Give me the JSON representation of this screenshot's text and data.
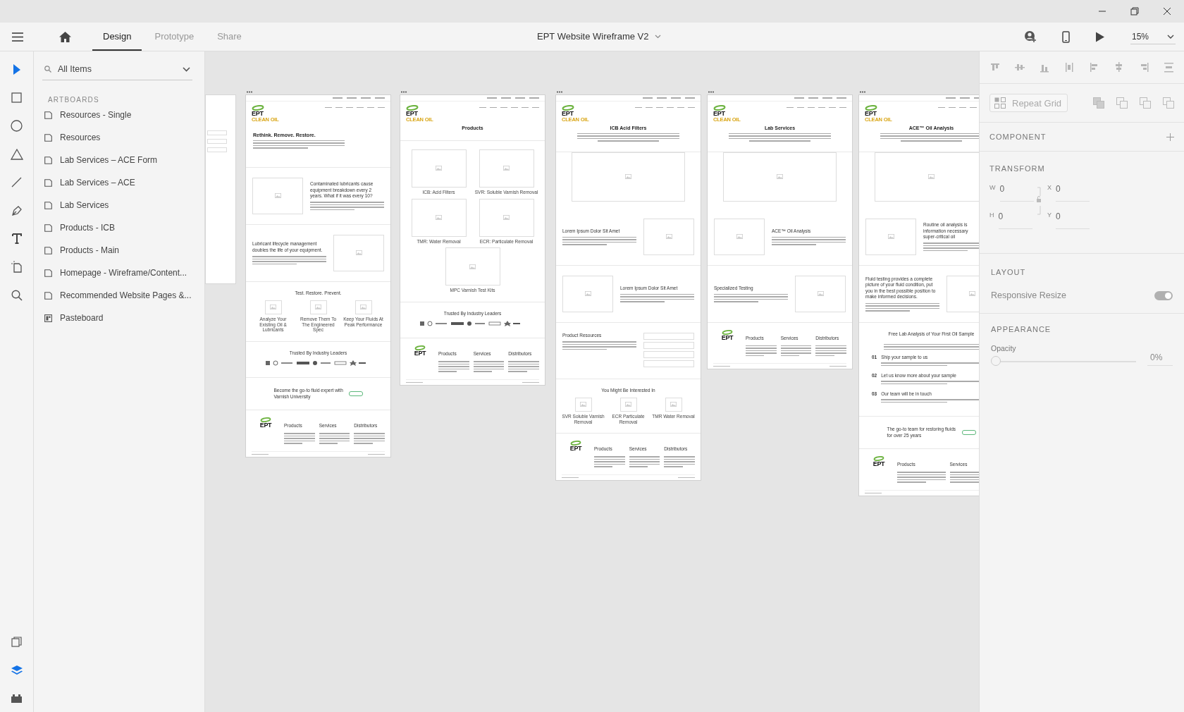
{
  "window": {
    "title": "EPT Website Wireframe V2"
  },
  "tabs": [
    {
      "label": "Design",
      "selected": true
    },
    {
      "label": "Prototype",
      "selected": false
    },
    {
      "label": "Share",
      "selected": false
    }
  ],
  "zoom": "15%",
  "tools": [
    {
      "kind": "select",
      "selected": true
    },
    {
      "kind": "rectangle",
      "selected": false
    },
    {
      "kind": "ellipse",
      "selected": false
    },
    {
      "kind": "polygon",
      "selected": false
    },
    {
      "kind": "line",
      "selected": false
    },
    {
      "kind": "pen",
      "selected": false
    },
    {
      "kind": "text",
      "selected": false
    },
    {
      "kind": "artboard",
      "selected": false
    },
    {
      "kind": "zoom",
      "selected": false
    }
  ],
  "bottom_tools": [
    {
      "kind": "assets",
      "selected": false
    },
    {
      "kind": "layers",
      "selected": true
    },
    {
      "kind": "plugins",
      "selected": false
    }
  ],
  "layers": {
    "filter": "All Items",
    "heading": "ARTBOARDS",
    "items": [
      {
        "label": "Resources - Single",
        "kind": "artboard"
      },
      {
        "label": "Resources",
        "kind": "artboard"
      },
      {
        "label": "Lab Services – ACE Form",
        "kind": "artboard"
      },
      {
        "label": "Lab Services – ACE",
        "kind": "artboard"
      },
      {
        "label": "Lab Services",
        "kind": "artboard"
      },
      {
        "label": "Products - ICB",
        "kind": "artboard"
      },
      {
        "label": "Products - Main",
        "kind": "artboard"
      },
      {
        "label": "Homepage - Wireframe/Content...",
        "kind": "artboard"
      },
      {
        "label": "Recommended Website Pages &...",
        "kind": "artboard"
      },
      {
        "label": "Pasteboard",
        "kind": "pasteboard"
      }
    ]
  },
  "properties": {
    "repeat_grid": "Repeat Grid",
    "component": "COMPONENT",
    "transform": "TRANSFORM",
    "fields": [
      {
        "label": "W",
        "value": "0"
      },
      {
        "label": "X",
        "value": "0"
      },
      {
        "label": "H",
        "value": "0"
      },
      {
        "label": "Y",
        "value": "0"
      }
    ],
    "layout": "LAYOUT",
    "responsive_resize": {
      "label": "Responsive Resize",
      "on": true
    },
    "appearance": "APPEARANCE",
    "opacity": {
      "label": "Opacity",
      "level": 0,
      "reading": "0%"
    }
  },
  "artboards": [
    {
      "sections": [
        {
          "kind": "hero_left",
          "logo": "EPT",
          "tagline": "CLEAN OIL",
          "title": "Rethink. Remove. Restore."
        },
        {
          "kind": "media_left",
          "title": "Contaminated lubricants cause equipment breakdown every 2 years. What if it was every 10?"
        },
        {
          "kind": "media_right",
          "title": "Lubricant lifecycle management doubles the life of your equipment."
        },
        {
          "kind": "icon_cards",
          "title": "Test. Restore. Prevent.",
          "items": [
            {
              "caption": "Analyze Your Existing Oil & Lubricants"
            },
            {
              "caption": "Remove Them To The Engineered Spec"
            },
            {
              "caption": "Keep Your Fluids At Peak Performance"
            }
          ]
        },
        {
          "kind": "logos",
          "title": "Trusted By Industry Leaders"
        },
        {
          "kind": "cta",
          "text": "Become the go-to fluid expert with Varnish University"
        },
        {
          "kind": "footer",
          "logo": "EPT",
          "columns": [
            "Products",
            "Services",
            "Distributors"
          ]
        }
      ]
    },
    {
      "sections": [
        {
          "kind": "hero_plain",
          "logo": "EPT",
          "tagline": "CLEAN OIL",
          "title": "Products"
        },
        {
          "kind": "tiles",
          "items": [
            {
              "caption": "ICB: Acid Filters"
            },
            {
              "caption": "SVR: Soluble Varnish Removal"
            },
            {
              "caption": "TMR: Water Removal"
            },
            {
              "caption": "ECR: Particulate Removal"
            },
            {
              "caption": "MPC Varnish Test Kits"
            }
          ]
        },
        {
          "kind": "logos",
          "title": "Trusted By Industry Leaders"
        },
        {
          "kind": "footer",
          "logo": "EPT",
          "columns": [
            "Products",
            "Services",
            "Distributors"
          ]
        }
      ]
    },
    {
      "sections": [
        {
          "kind": "hero_center",
          "logo": "EPT",
          "tagline": "CLEAN OIL",
          "title": "ICB Acid Filters"
        },
        {
          "kind": "banner"
        },
        {
          "kind": "media_right",
          "title": "Lorem Ipsum Dolor Sit Amet"
        },
        {
          "kind": "media_left",
          "title": "Lorem Ipsum Dolor Sit Amet"
        },
        {
          "kind": "links",
          "title": "Product Resources"
        },
        {
          "kind": "icon_cards",
          "title": "You Might Be Interested In",
          "items": [
            {
              "caption": "SVR Soluble Varnish Removal"
            },
            {
              "caption": "ECR Particulate Removal"
            },
            {
              "caption": "TMR Water Removal"
            }
          ]
        },
        {
          "kind": "footer",
          "logo": "EPT",
          "columns": [
            "Products",
            "Services",
            "Distributors"
          ]
        }
      ]
    },
    {
      "sections": [
        {
          "kind": "hero_center",
          "logo": "EPT",
          "tagline": "CLEAN OIL",
          "title": "Lab Services"
        },
        {
          "kind": "banner"
        },
        {
          "kind": "media_left",
          "title": "ACE™ Oil Analysis"
        },
        {
          "kind": "media_right",
          "title": "Specialized Testing"
        },
        {
          "kind": "footer",
          "logo": "EPT",
          "columns": [
            "Products",
            "Services",
            "Distributors"
          ]
        }
      ]
    },
    {
      "sections": [
        {
          "kind": "hero_center",
          "logo": "EPT",
          "tagline": "CLEAN OIL",
          "title": "ACE™ Oil Analysis"
        },
        {
          "kind": "banner"
        },
        {
          "kind": "media_cut",
          "title_lines": [
            "Routine oil analysis is",
            "information necessary",
            "super-critical oil"
          ]
        },
        {
          "kind": "media_right",
          "title": "Fluid testing provides a complete picture of your fluid condition, put you in the best possible position to make informed decisions."
        },
        {
          "kind": "steps",
          "title": "Free Lab Analysis of Your First Oil Sample",
          "items": [
            {
              "number": "01",
              "text": "Ship your sample to us"
            },
            {
              "number": "02",
              "text": "Let us know more about your sample"
            },
            {
              "number": "03",
              "text": "Our team will be in touch"
            }
          ]
        },
        {
          "kind": "cta",
          "text": "The go-to team for restoring fluids for over 25 years"
        },
        {
          "kind": "footer",
          "logo": "EPT",
          "columns": [
            "Products",
            "Services"
          ]
        }
      ]
    }
  ]
}
